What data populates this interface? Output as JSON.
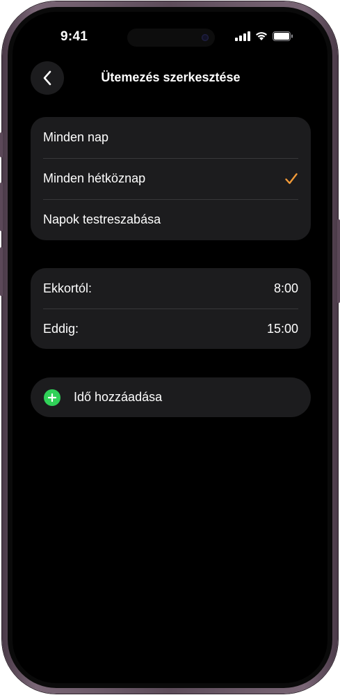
{
  "status_bar": {
    "time": "9:41"
  },
  "header": {
    "title": "Ütemezés szerkesztése",
    "back_icon": "chevron-left-icon"
  },
  "repeat_options": [
    {
      "label": "Minden nap",
      "selected": false
    },
    {
      "label": "Minden hétköznap",
      "selected": true
    },
    {
      "label": "Napok testreszabása",
      "selected": false
    }
  ],
  "time_range": {
    "from_label": "Ekkortól:",
    "from_value": "8:00",
    "to_label": "Eddig:",
    "to_value": "15:00"
  },
  "add_time": {
    "label": "Idő hozzáadása",
    "icon": "plus-circle-icon"
  },
  "colors": {
    "accent_check": "#f19a38",
    "add_icon": "#30d158",
    "cell_background": "#1c1c1e"
  }
}
